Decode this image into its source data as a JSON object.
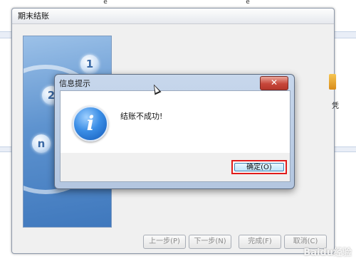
{
  "background_window": {
    "title": "期末结账",
    "art_numbers": [
      "1",
      "2",
      "n"
    ],
    "buttons": {
      "prev": "上一步(P)",
      "next": "下一步(N)",
      "finish": "完成(F)",
      "cancel": "取消(C)"
    },
    "right_edge_text": "凭"
  },
  "dialog": {
    "title": "信息提示",
    "message": "结账不成功!",
    "ok_label": "确定(O)",
    "close_glyph": "✕",
    "icon": "info-icon"
  },
  "watermark": "Baidu经验",
  "colors": {
    "highlight_border": "#e01b1b",
    "close_button": "#c7463a",
    "info_icon": "#1f6fd0"
  }
}
